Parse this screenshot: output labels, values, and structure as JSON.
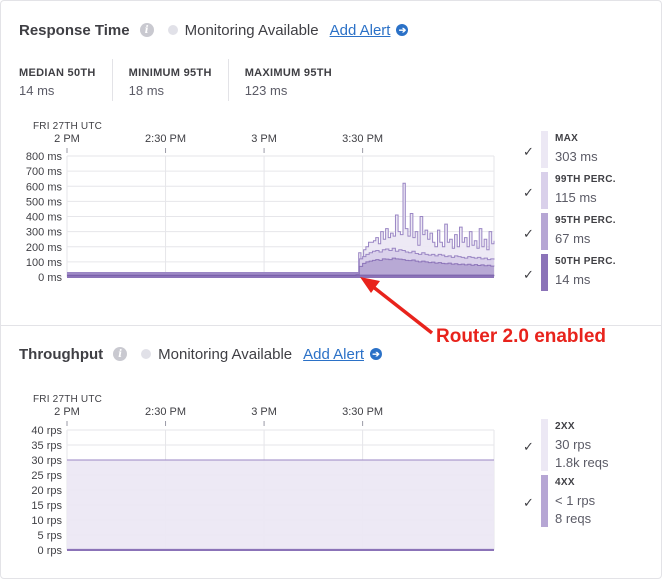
{
  "response_time": {
    "title": "Response Time",
    "monitoring": "Monitoring Available",
    "add_alert": "Add Alert",
    "stats": [
      {
        "label": "MEDIAN 50TH",
        "value": "14 ms"
      },
      {
        "label": "MINIMUM 95TH",
        "value": "18 ms"
      },
      {
        "label": "MAXIMUM 95TH",
        "value": "123 ms"
      }
    ],
    "date_label": "FRI 27TH UTC",
    "legend": [
      {
        "name": "MAX",
        "value": "303 ms",
        "color": "#ece8f4"
      },
      {
        "name": "99TH PERC.",
        "value": "115 ms",
        "color": "#d9d0ea"
      },
      {
        "name": "95TH PERC.",
        "value": "67 ms",
        "color": "#b6a6d4"
      },
      {
        "name": "50TH PERC.",
        "value": "14 ms",
        "color": "#8b73b8"
      }
    ]
  },
  "throughput": {
    "title": "Throughput",
    "monitoring": "Monitoring Available",
    "add_alert": "Add Alert",
    "date_label": "FRI 27TH UTC",
    "legend": [
      {
        "name": "2XX",
        "value": "30 rps",
        "sub": "1.8k reqs",
        "color": "#ece8f4"
      },
      {
        "name": "4XX",
        "value": "< 1 rps",
        "sub": "8 reqs",
        "color": "#b6a6d4"
      }
    ]
  },
  "annotation": "Router 2.0 enabled",
  "chart_data": [
    {
      "type": "area",
      "x_ticks": [
        "2 PM",
        "2:30 PM",
        "3 PM",
        "3:30 PM"
      ],
      "y_ticks": [
        "800 ms",
        "700 ms",
        "600 ms",
        "500 ms",
        "400 ms",
        "300 ms",
        "200 ms",
        "100 ms",
        "0 ms"
      ],
      "ylim": [
        0,
        800
      ],
      "xlim_minutes": [
        0,
        130
      ],
      "x_tick_minutes": [
        0,
        30,
        60,
        90
      ],
      "series": [
        {
          "name": "MAX",
          "color": "#ece8f4",
          "stroke": "#9a86c4",
          "x": [
            0,
            88,
            88.8,
            89.5,
            90.3,
            91,
            91.8,
            92.5,
            93.3,
            94,
            94.8,
            95.5,
            96.3,
            97,
            97.8,
            98.5,
            99.3,
            100,
            100.8,
            101.5,
            102.3,
            103,
            103.8,
            104.5,
            105.3,
            106,
            106.8,
            107.5,
            108.3,
            109,
            109.8,
            110.5,
            111.3,
            112,
            112.8,
            113.5,
            114.3,
            115,
            115.8,
            116.5,
            117.3,
            118,
            118.8,
            119.5,
            120.3,
            121,
            121.8,
            122.5,
            123.3,
            124,
            124.8,
            125.5,
            126.3,
            127,
            127.8,
            128.5,
            129.3,
            130
          ],
          "values": [
            30,
            30,
            160,
            120,
            180,
            200,
            230,
            230,
            240,
            260,
            220,
            300,
            250,
            320,
            260,
            290,
            270,
            410,
            300,
            280,
            620,
            320,
            270,
            420,
            260,
            300,
            210,
            400,
            280,
            310,
            250,
            290,
            230,
            200,
            310,
            230,
            200,
            350,
            230,
            250,
            190,
            280,
            200,
            330,
            230,
            260,
            200,
            300,
            210,
            240,
            190,
            320,
            200,
            250,
            180,
            300,
            220,
            240
          ]
        },
        {
          "name": "99TH PERC.",
          "color": "#d9d0ea",
          "stroke": "#9a86c4",
          "x": [
            0,
            88,
            89,
            90,
            91,
            92,
            93,
            94,
            95,
            96,
            97,
            98,
            99,
            100,
            101,
            102,
            103,
            104,
            105,
            106,
            107,
            108,
            109,
            110,
            111,
            112,
            113,
            114,
            115,
            116,
            117,
            118,
            119,
            120,
            121,
            122,
            123,
            124,
            125,
            126,
            127,
            128,
            129,
            130
          ],
          "values": [
            25,
            25,
            120,
            135,
            150,
            160,
            170,
            175,
            165,
            180,
            185,
            175,
            190,
            170,
            180,
            175,
            165,
            160,
            170,
            155,
            150,
            160,
            150,
            145,
            150,
            140,
            150,
            145,
            135,
            140,
            130,
            140,
            135,
            130,
            125,
            135,
            130,
            125,
            130,
            120,
            125,
            115,
            120,
            115
          ]
        },
        {
          "name": "95TH PERC.",
          "color": "#b6a6d4",
          "stroke": "#8b73b8",
          "x": [
            0,
            88,
            89,
            90,
            91,
            92,
            93,
            94,
            95,
            96,
            97,
            98,
            99,
            100,
            101,
            102,
            103,
            104,
            105,
            106,
            107,
            108,
            109,
            110,
            111,
            112,
            113,
            114,
            115,
            116,
            117,
            118,
            119,
            120,
            121,
            122,
            123,
            124,
            125,
            126,
            127,
            128,
            129,
            130
          ],
          "values": [
            18,
            18,
            70,
            90,
            100,
            105,
            110,
            115,
            110,
            120,
            118,
            115,
            125,
            120,
            118,
            115,
            110,
            108,
            112,
            105,
            100,
            105,
            100,
            95,
            98,
            92,
            95,
            90,
            88,
            92,
            85,
            88,
            82,
            85,
            80,
            84,
            78,
            82,
            76,
            80,
            74,
            78,
            72,
            70
          ]
        },
        {
          "name": "50TH PERC.",
          "color": "#8b73b8",
          "stroke": "#7a60ab",
          "x": [
            0,
            88,
            130
          ],
          "values": [
            10,
            12,
            14
          ]
        }
      ]
    },
    {
      "type": "area",
      "x_ticks": [
        "2 PM",
        "2:30 PM",
        "3 PM",
        "3:30 PM"
      ],
      "y_ticks": [
        "40 rps",
        "35 rps",
        "30 rps",
        "25 rps",
        "20 rps",
        "15 rps",
        "10 rps",
        "5 rps",
        "0 rps"
      ],
      "ylim": [
        0,
        40
      ],
      "xlim_minutes": [
        0,
        130
      ],
      "x_tick_minutes": [
        0,
        30,
        60,
        90
      ],
      "series": [
        {
          "name": "2XX",
          "color": "#ece8f4",
          "stroke": "#9a86c4",
          "x": [
            0,
            130
          ],
          "values": [
            30,
            30
          ]
        },
        {
          "name": "4XX",
          "color": "#b6a6d4",
          "stroke": "#8b73b8",
          "x": [
            0,
            130
          ],
          "values": [
            0.2,
            0.2
          ]
        }
      ]
    }
  ]
}
